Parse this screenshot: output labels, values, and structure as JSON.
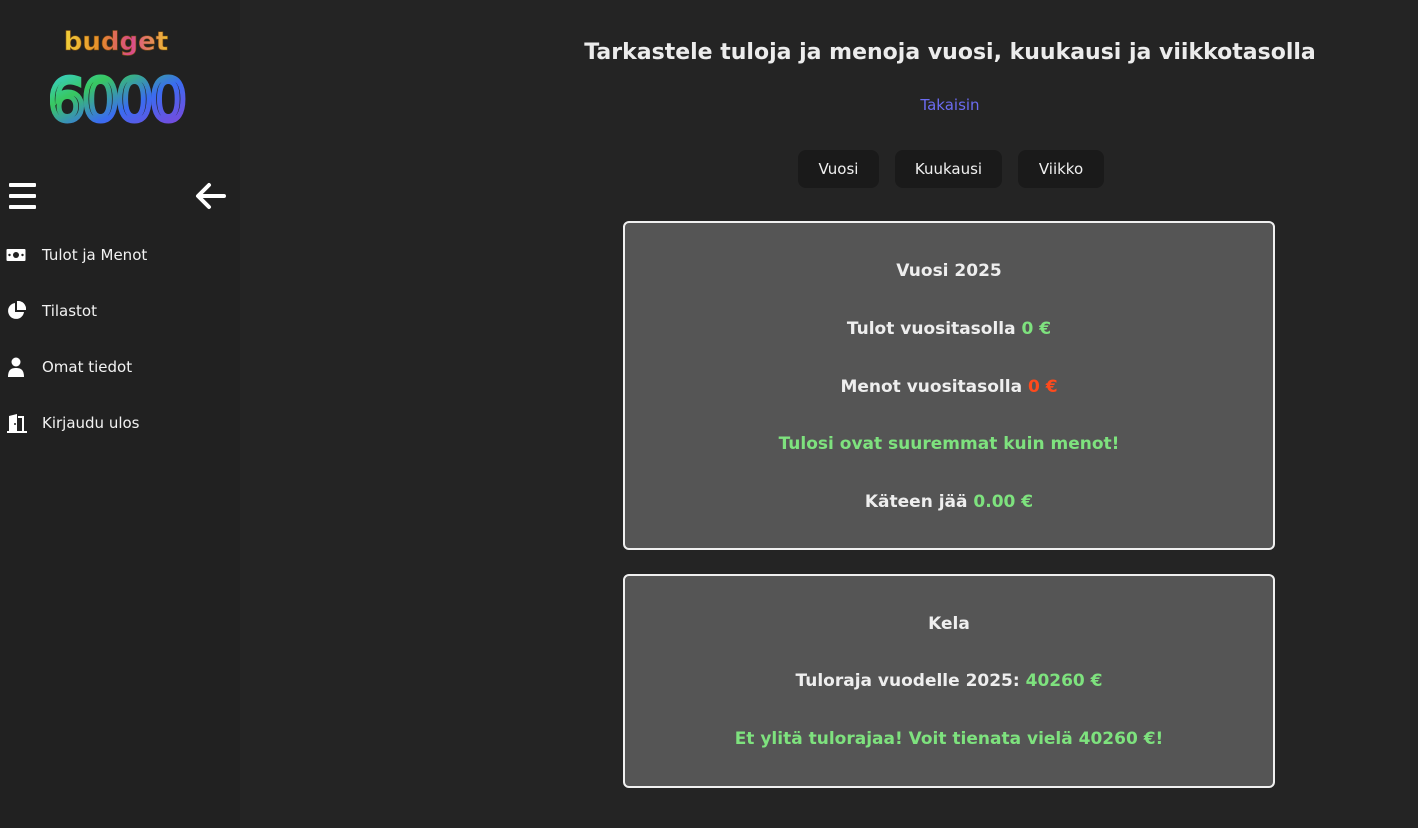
{
  "sidebar": {
    "logo": {
      "word": "budget",
      "number": "6000"
    },
    "menu_icon": "hamburger-icon",
    "back_icon": "arrow-left-icon",
    "items": [
      {
        "label": "Tulot ja Menot",
        "icon": "money-icon"
      },
      {
        "label": "Tilastot",
        "icon": "pie-chart-icon"
      },
      {
        "label": "Omat tiedot",
        "icon": "user-icon"
      },
      {
        "label": "Kirjaudu ulos",
        "icon": "door-exit-icon"
      }
    ]
  },
  "main": {
    "title": "Tarkastele tuloja ja menoja vuosi, kuukausi ja viikkotasolla",
    "back_link": "Takaisin",
    "tabs": [
      {
        "label": "Vuosi"
      },
      {
        "label": "Kuukausi"
      },
      {
        "label": "Viikko"
      }
    ],
    "summary_card": {
      "title": "Vuosi 2025",
      "income_label": "Tulot vuositasolla",
      "income_value": "0 €",
      "expense_label": "Menot vuositasolla",
      "expense_value": "0 €",
      "status_message": "Tulosi ovat suuremmat kuin menot!",
      "remaining_label": "Käteen jää",
      "remaining_value": "0.00 €"
    },
    "kela_card": {
      "title": "Kela",
      "limit_label": "Tuloraja vuodelle 2025:",
      "limit_value": "40260 €",
      "status_message": "Et ylitä tulorajaa! Voit tienata vielä 40260 €!"
    }
  },
  "colors": {
    "background": "#242424",
    "sidebar": "#212121",
    "card": "#555555",
    "positive": "#7ee27e",
    "negative": "#ff4a1c",
    "link": "#6b6bf0"
  }
}
